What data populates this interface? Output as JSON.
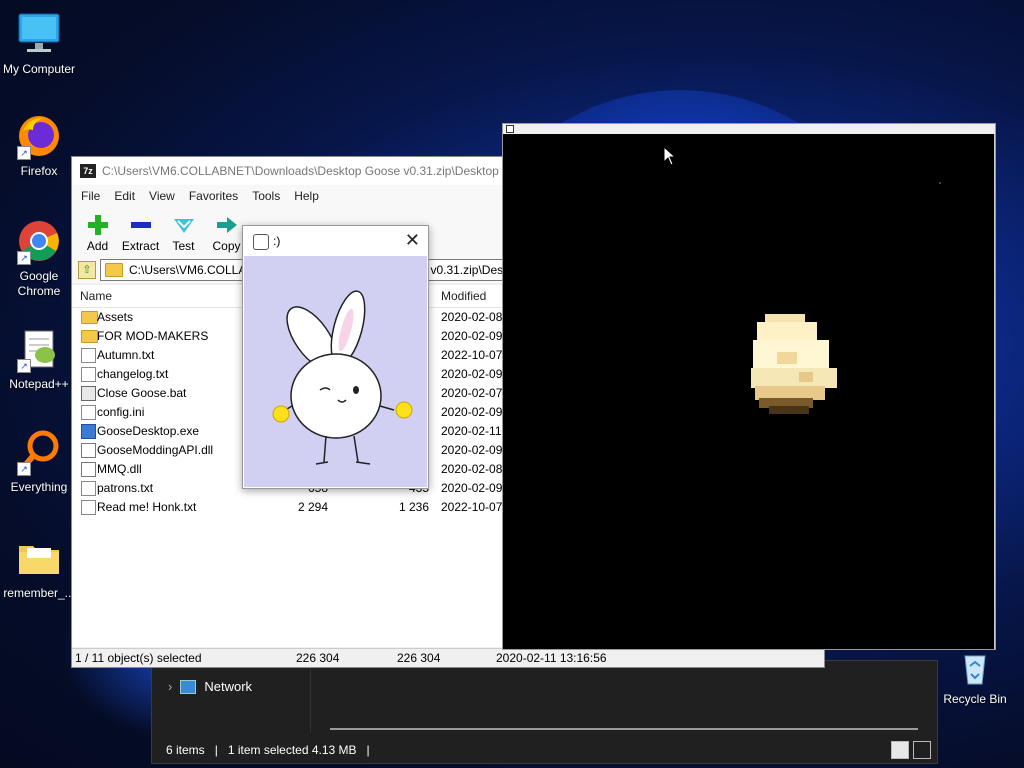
{
  "desktop": {
    "icons": [
      {
        "label": "My Computer",
        "icon": "monitor-icon"
      },
      {
        "label": "Firefox",
        "icon": "firefox-icon"
      },
      {
        "label": "Google Chrome",
        "icon": "chrome-icon"
      },
      {
        "label": "Notepad++",
        "icon": "notepadpp-icon"
      },
      {
        "label": "Everything",
        "icon": "everything-search-icon"
      },
      {
        "label": "remember_...",
        "icon": "folder-icon"
      },
      {
        "label": "Recycle Bin",
        "icon": "recycle-bin-icon"
      }
    ]
  },
  "explorer": {
    "nav_network": "Network",
    "status": {
      "items": "6 items",
      "selected": "1 item selected  4.13 MB",
      "sep": "|"
    }
  },
  "zip": {
    "title": "C:\\Users\\VM6.COLLABNET\\Downloads\\Desktop Goose v0.31.zip\\Desktop Goose",
    "logo": "7z",
    "menu": [
      "File",
      "Edit",
      "View",
      "Favorites",
      "Tools",
      "Help"
    ],
    "toolbar": [
      {
        "label": "Add",
        "icon": "add-plus-icon"
      },
      {
        "label": "Extract",
        "icon": "extract-minus-icon"
      },
      {
        "label": "Test",
        "icon": "test-check-icon"
      },
      {
        "label": "Copy",
        "icon": "copy-arrow-icon"
      },
      {
        "label": "",
        "icon": "move-arrow-icon"
      },
      {
        "label": "",
        "icon": "delete-x-icon"
      },
      {
        "label": "",
        "icon": "info-icon"
      }
    ],
    "address": "C:\\Users\\VM6.COLLABNET\\Downloads\\Desktop Goose v0.31.zip\\Desktop Goose\\",
    "columns": {
      "name": "Name",
      "modified": "Modified"
    },
    "files": [
      {
        "name": "Assets",
        "size": "",
        "packed": "",
        "modified": "2020-02-08",
        "type": "folder"
      },
      {
        "name": "FOR MOD-MAKERS",
        "size": "",
        "packed": "",
        "modified": "2020-02-09",
        "type": "folder"
      },
      {
        "name": "Autumn.txt",
        "size": "",
        "packed": "",
        "modified": "2022-10-07",
        "type": "file"
      },
      {
        "name": "changelog.txt",
        "size": "",
        "packed": "",
        "modified": "2020-02-09",
        "type": "file"
      },
      {
        "name": "Close Goose.bat",
        "size": "",
        "packed": "",
        "modified": "2020-02-07",
        "type": "bat"
      },
      {
        "name": "config.ini",
        "size": "",
        "packed": "",
        "modified": "2020-02-09",
        "type": "file"
      },
      {
        "name": "GooseDesktop.exe",
        "size": "",
        "packed": "",
        "modified": "2020-02-11",
        "type": "exe"
      },
      {
        "name": "GooseModdingAPI.dll",
        "size": "",
        "packed": "",
        "modified": "2020-02-09",
        "type": "dll"
      },
      {
        "name": "MMQ.dll",
        "size": "",
        "packed": "",
        "modified": "2020-02-08",
        "type": "dll"
      },
      {
        "name": "patrons.txt",
        "size": "658",
        "packed": "435",
        "modified": "2020-02-09",
        "type": "file"
      },
      {
        "name": "Read me! Honk.txt",
        "size": "2 294",
        "packed": "1 236",
        "modified": "2022-10-07",
        "type": "file"
      }
    ],
    "status": {
      "selected": "1 / 11 object(s) selected",
      "size": "226 304",
      "packed": "226 304",
      "modified": "2020-02-11 13:16:56"
    }
  },
  "popup": {
    "title": ":)",
    "close": "✕"
  },
  "colors": {
    "popup_bg": "#d1d0f3",
    "desktop_accent": "#1a4fd0"
  }
}
